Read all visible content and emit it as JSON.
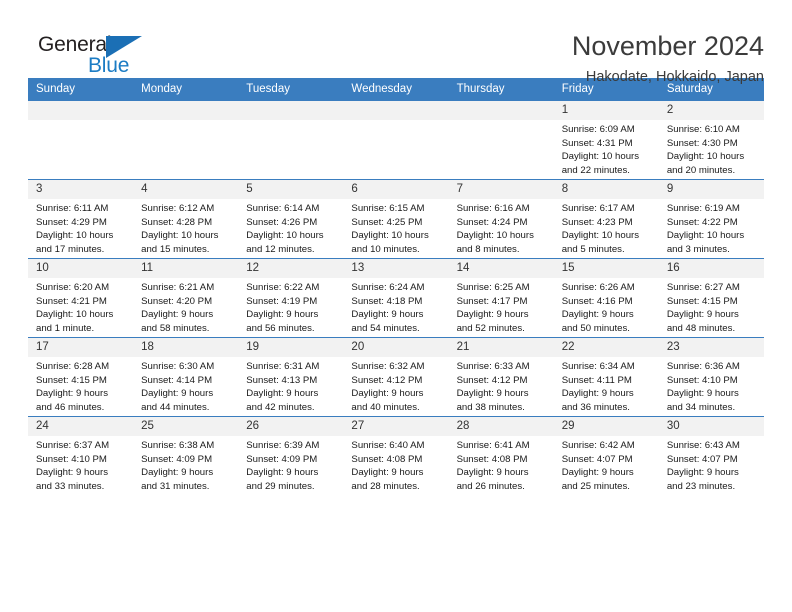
{
  "brand": {
    "name_part1": "General",
    "name_part2": "Blue",
    "mark": "triangle-logo"
  },
  "header": {
    "month_title": "November 2024",
    "location": "Hakodate, Hokkaido, Japan"
  },
  "colors": {
    "header_blue": "#3a7dbf",
    "brand_blue": "#1c7cc4",
    "daynum_background": "#f2f2f2",
    "text": "#1a1a1a"
  },
  "weekday_headers": [
    "Sunday",
    "Monday",
    "Tuesday",
    "Wednesday",
    "Thursday",
    "Friday",
    "Saturday"
  ],
  "labels": {
    "sunrise_prefix": "Sunrise:",
    "sunset_prefix": "Sunset:",
    "daylight_prefix": "Daylight:"
  },
  "weeks": [
    [
      {
        "day": "",
        "empty": true
      },
      {
        "day": "",
        "empty": true
      },
      {
        "day": "",
        "empty": true
      },
      {
        "day": "",
        "empty": true
      },
      {
        "day": "",
        "empty": true
      },
      {
        "day": "1",
        "sunrise": "Sunrise: 6:09 AM",
        "sunset": "Sunset: 4:31 PM",
        "daylight_line1": "Daylight: 10 hours",
        "daylight_line2": "and 22 minutes."
      },
      {
        "day": "2",
        "sunrise": "Sunrise: 6:10 AM",
        "sunset": "Sunset: 4:30 PM",
        "daylight_line1": "Daylight: 10 hours",
        "daylight_line2": "and 20 minutes."
      }
    ],
    [
      {
        "day": "3",
        "sunrise": "Sunrise: 6:11 AM",
        "sunset": "Sunset: 4:29 PM",
        "daylight_line1": "Daylight: 10 hours",
        "daylight_line2": "and 17 minutes."
      },
      {
        "day": "4",
        "sunrise": "Sunrise: 6:12 AM",
        "sunset": "Sunset: 4:28 PM",
        "daylight_line1": "Daylight: 10 hours",
        "daylight_line2": "and 15 minutes."
      },
      {
        "day": "5",
        "sunrise": "Sunrise: 6:14 AM",
        "sunset": "Sunset: 4:26 PM",
        "daylight_line1": "Daylight: 10 hours",
        "daylight_line2": "and 12 minutes."
      },
      {
        "day": "6",
        "sunrise": "Sunrise: 6:15 AM",
        "sunset": "Sunset: 4:25 PM",
        "daylight_line1": "Daylight: 10 hours",
        "daylight_line2": "and 10 minutes."
      },
      {
        "day": "7",
        "sunrise": "Sunrise: 6:16 AM",
        "sunset": "Sunset: 4:24 PM",
        "daylight_line1": "Daylight: 10 hours",
        "daylight_line2": "and 8 minutes."
      },
      {
        "day": "8",
        "sunrise": "Sunrise: 6:17 AM",
        "sunset": "Sunset: 4:23 PM",
        "daylight_line1": "Daylight: 10 hours",
        "daylight_line2": "and 5 minutes."
      },
      {
        "day": "9",
        "sunrise": "Sunrise: 6:19 AM",
        "sunset": "Sunset: 4:22 PM",
        "daylight_line1": "Daylight: 10 hours",
        "daylight_line2": "and 3 minutes."
      }
    ],
    [
      {
        "day": "10",
        "sunrise": "Sunrise: 6:20 AM",
        "sunset": "Sunset: 4:21 PM",
        "daylight_line1": "Daylight: 10 hours",
        "daylight_line2": "and 1 minute."
      },
      {
        "day": "11",
        "sunrise": "Sunrise: 6:21 AM",
        "sunset": "Sunset: 4:20 PM",
        "daylight_line1": "Daylight: 9 hours",
        "daylight_line2": "and 58 minutes."
      },
      {
        "day": "12",
        "sunrise": "Sunrise: 6:22 AM",
        "sunset": "Sunset: 4:19 PM",
        "daylight_line1": "Daylight: 9 hours",
        "daylight_line2": "and 56 minutes."
      },
      {
        "day": "13",
        "sunrise": "Sunrise: 6:24 AM",
        "sunset": "Sunset: 4:18 PM",
        "daylight_line1": "Daylight: 9 hours",
        "daylight_line2": "and 54 minutes."
      },
      {
        "day": "14",
        "sunrise": "Sunrise: 6:25 AM",
        "sunset": "Sunset: 4:17 PM",
        "daylight_line1": "Daylight: 9 hours",
        "daylight_line2": "and 52 minutes."
      },
      {
        "day": "15",
        "sunrise": "Sunrise: 6:26 AM",
        "sunset": "Sunset: 4:16 PM",
        "daylight_line1": "Daylight: 9 hours",
        "daylight_line2": "and 50 minutes."
      },
      {
        "day": "16",
        "sunrise": "Sunrise: 6:27 AM",
        "sunset": "Sunset: 4:15 PM",
        "daylight_line1": "Daylight: 9 hours",
        "daylight_line2": "and 48 minutes."
      }
    ],
    [
      {
        "day": "17",
        "sunrise": "Sunrise: 6:28 AM",
        "sunset": "Sunset: 4:15 PM",
        "daylight_line1": "Daylight: 9 hours",
        "daylight_line2": "and 46 minutes."
      },
      {
        "day": "18",
        "sunrise": "Sunrise: 6:30 AM",
        "sunset": "Sunset: 4:14 PM",
        "daylight_line1": "Daylight: 9 hours",
        "daylight_line2": "and 44 minutes."
      },
      {
        "day": "19",
        "sunrise": "Sunrise: 6:31 AM",
        "sunset": "Sunset: 4:13 PM",
        "daylight_line1": "Daylight: 9 hours",
        "daylight_line2": "and 42 minutes."
      },
      {
        "day": "20",
        "sunrise": "Sunrise: 6:32 AM",
        "sunset": "Sunset: 4:12 PM",
        "daylight_line1": "Daylight: 9 hours",
        "daylight_line2": "and 40 minutes."
      },
      {
        "day": "21",
        "sunrise": "Sunrise: 6:33 AM",
        "sunset": "Sunset: 4:12 PM",
        "daylight_line1": "Daylight: 9 hours",
        "daylight_line2": "and 38 minutes."
      },
      {
        "day": "22",
        "sunrise": "Sunrise: 6:34 AM",
        "sunset": "Sunset: 4:11 PM",
        "daylight_line1": "Daylight: 9 hours",
        "daylight_line2": "and 36 minutes."
      },
      {
        "day": "23",
        "sunrise": "Sunrise: 6:36 AM",
        "sunset": "Sunset: 4:10 PM",
        "daylight_line1": "Daylight: 9 hours",
        "daylight_line2": "and 34 minutes."
      }
    ],
    [
      {
        "day": "24",
        "sunrise": "Sunrise: 6:37 AM",
        "sunset": "Sunset: 4:10 PM",
        "daylight_line1": "Daylight: 9 hours",
        "daylight_line2": "and 33 minutes."
      },
      {
        "day": "25",
        "sunrise": "Sunrise: 6:38 AM",
        "sunset": "Sunset: 4:09 PM",
        "daylight_line1": "Daylight: 9 hours",
        "daylight_line2": "and 31 minutes."
      },
      {
        "day": "26",
        "sunrise": "Sunrise: 6:39 AM",
        "sunset": "Sunset: 4:09 PM",
        "daylight_line1": "Daylight: 9 hours",
        "daylight_line2": "and 29 minutes."
      },
      {
        "day": "27",
        "sunrise": "Sunrise: 6:40 AM",
        "sunset": "Sunset: 4:08 PM",
        "daylight_line1": "Daylight: 9 hours",
        "daylight_line2": "and 28 minutes."
      },
      {
        "day": "28",
        "sunrise": "Sunrise: 6:41 AM",
        "sunset": "Sunset: 4:08 PM",
        "daylight_line1": "Daylight: 9 hours",
        "daylight_line2": "and 26 minutes."
      },
      {
        "day": "29",
        "sunrise": "Sunrise: 6:42 AM",
        "sunset": "Sunset: 4:07 PM",
        "daylight_line1": "Daylight: 9 hours",
        "daylight_line2": "and 25 minutes."
      },
      {
        "day": "30",
        "sunrise": "Sunrise: 6:43 AM",
        "sunset": "Sunset: 4:07 PM",
        "daylight_line1": "Daylight: 9 hours",
        "daylight_line2": "and 23 minutes."
      }
    ]
  ]
}
